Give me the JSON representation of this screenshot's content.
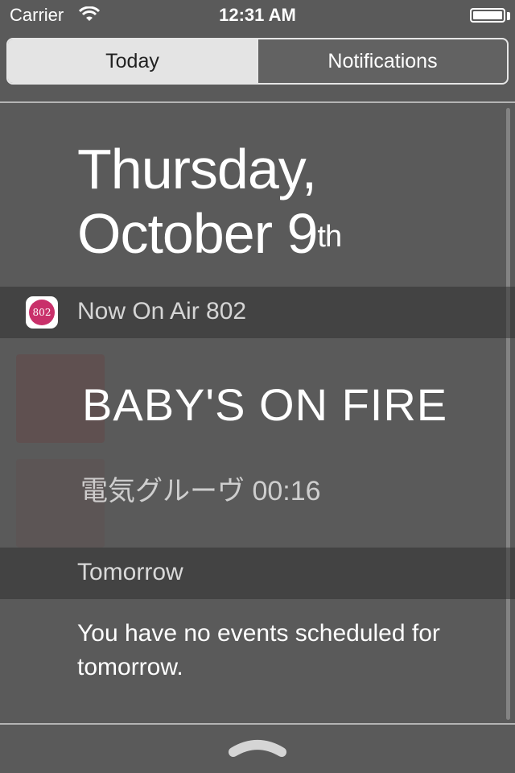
{
  "status_bar": {
    "carrier": "Carrier",
    "time": "12:31 AM"
  },
  "tabs": {
    "today": "Today",
    "notifications": "Notifications"
  },
  "date": {
    "line1": "Thursday,",
    "line2": "October 9",
    "suffix": "th"
  },
  "widget": {
    "app_name": "Now On Air 802",
    "icon_text": "802",
    "song_title": "BABY'S ON FIRE",
    "artist_time": "電気グルーヴ 00:16"
  },
  "tomorrow": {
    "title": "Tomorrow",
    "message": "You have no events scheduled for tomorrow."
  },
  "colors": {
    "app_icon_accent": "#c9306a"
  }
}
